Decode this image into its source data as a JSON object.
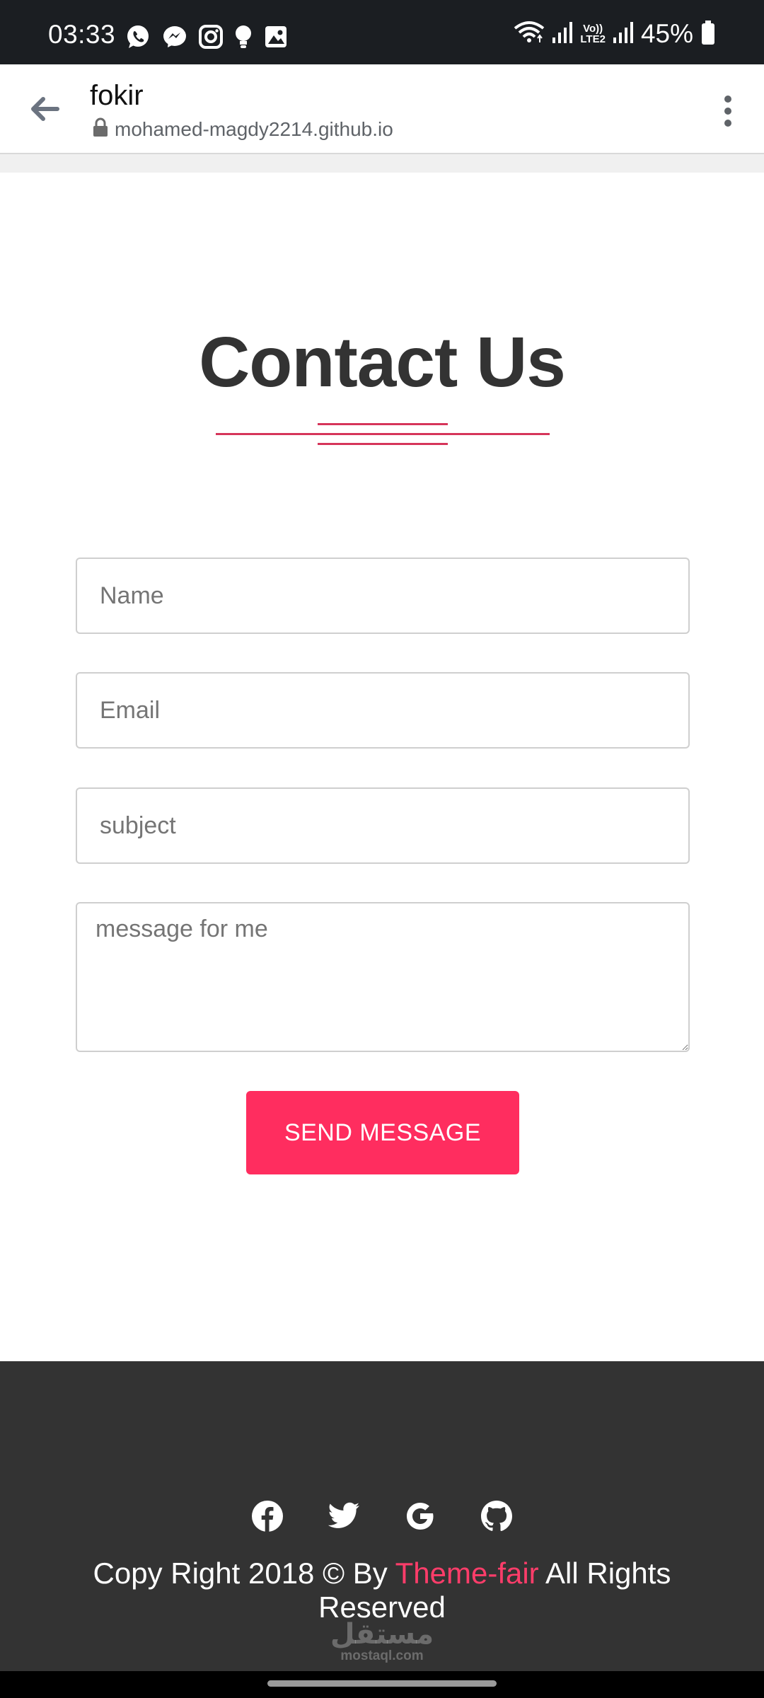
{
  "status_bar": {
    "time": "03:33",
    "notification_icons": [
      "whatsapp-icon",
      "messenger-icon",
      "instagram-icon",
      "bulb-icon",
      "gallery-icon"
    ],
    "network_label_top": "Vo))",
    "network_label_bottom": "LTE2",
    "battery_percent": "45%"
  },
  "browser": {
    "page_title": "fokir",
    "url": "mohamed-magdy2214.github.io"
  },
  "contact": {
    "heading": "Contact Us",
    "form": {
      "name_placeholder": "Name",
      "email_placeholder": "Email",
      "subject_placeholder": "subject",
      "message_placeholder": "message for me",
      "submit_label": "SEND MESSAGE"
    }
  },
  "footer": {
    "social_icons": [
      "facebook-icon",
      "twitter-icon",
      "google-icon",
      "github-icon"
    ],
    "copyright_prefix": "Copy Right 2018 © By ",
    "copyright_link": "Theme-fair",
    "copyright_suffix": " All Rights Reserved",
    "watermark_arabic": "مستقل",
    "watermark_latin": "mostaql.com"
  },
  "colors": {
    "accent": "#ff2d5f",
    "heading_line": "#d6355a",
    "footer_bg": "#333333",
    "status_bar_bg": "#1b1e22",
    "heading_text": "#333333"
  }
}
